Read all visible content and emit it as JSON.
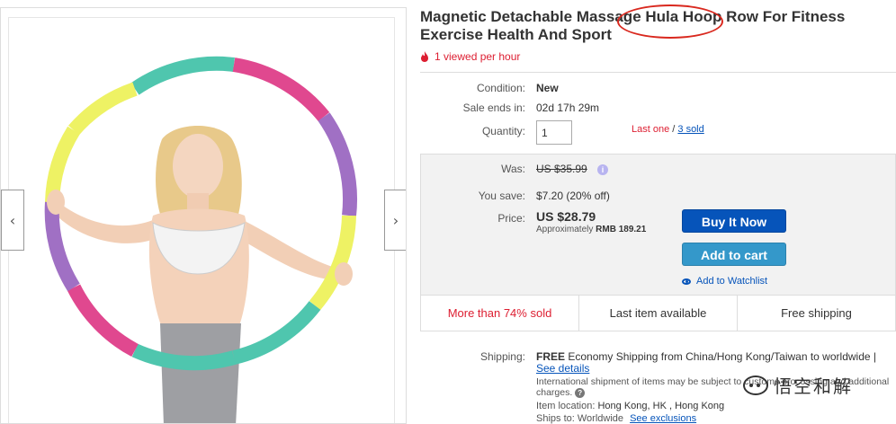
{
  "product": {
    "title": "Magnetic Detachable Massage Hula Hoop Row For Fitness Exercise Health And Sport",
    "views": "1 viewed per hour"
  },
  "gallery": {
    "prev_arrow": "‹",
    "next_arrow": "›"
  },
  "details": {
    "condition_label": "Condition:",
    "condition_value": "New",
    "sale_ends_label": "Sale ends in:",
    "sale_ends_value": "02d 17h 29m",
    "quantity_label": "Quantity:",
    "quantity_value": "1",
    "last_one": "Last one",
    "slash": "/",
    "sold_link": "3 sold"
  },
  "pricing": {
    "was_label": "Was:",
    "was_value": "US $35.99",
    "info_glyph": "i",
    "you_save_label": "You save:",
    "you_save_value": "$7.20 (20% off)",
    "price_label": "Price:",
    "price_value": "US $28.79",
    "approx_text": "Approximately",
    "approx_value": "RMB 189.21",
    "buy_now": "Buy It Now",
    "add_to_cart": "Add to cart",
    "watchlist": "Add to Watchlist"
  },
  "highlights": [
    "More than 74% sold",
    "Last item available",
    "Free shipping"
  ],
  "shipping": {
    "label": "Shipping:",
    "free": "FREE",
    "method": "Economy Shipping from China/Hong Kong/Taiwan to worldwide |",
    "see_details": "See details",
    "international_note": "International shipment of items may be subject to customs processing and additional charges.",
    "help_glyph": "?",
    "item_location_label": "Item location:",
    "item_location_value": "Hong Kong, HK , Hong Kong",
    "ships_to_label": "Ships to:",
    "ships_to_value": "Worldwide",
    "see_exclusions": "See exclusions"
  },
  "watermark": {
    "text": "悟空和解"
  },
  "colors": {
    "accent_blue": "#0654ba",
    "cart_blue": "#3498ca",
    "alert_red": "#dd1e31",
    "hoop_teal": "#4fc6ae",
    "hoop_pink": "#e0488f",
    "hoop_yellow": "#eef264",
    "hoop_purple": "#a070c4"
  },
  "icons": [
    "flame-icon",
    "info-icon",
    "eye-icon",
    "help-icon",
    "chevron-left-icon",
    "chevron-right-icon"
  ]
}
